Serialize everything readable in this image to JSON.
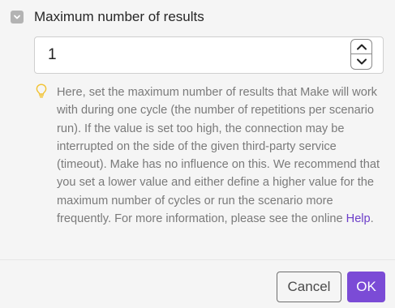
{
  "field": {
    "label": "Maximum number of results",
    "value": "1",
    "collapse_icon": "chevron-down-icon",
    "stepper_icons": [
      "chevron-up-icon",
      "chevron-down-icon"
    ]
  },
  "hint": {
    "icon": "lightbulb-icon",
    "text": "Here, set the maximum number of results that Make will work with during one cycle (the number of repetitions per scenario run). If the value is set too high, the connection may be interrupted on the side of the given third-party service (timeout). Make has no influence on this. We recommend that you set a lower value and either define a higher value for the maximum number of cycles or run the scenario more frequently. For more information, please see the online ",
    "link_text": "Help",
    "trailing": "."
  },
  "footer": {
    "cancel_label": "Cancel",
    "ok_label": "OK"
  },
  "colors": {
    "accent": "#7b4bd6",
    "link": "#6d3fc9",
    "hint_icon": "#f2c230",
    "background": "#f5f5f5"
  }
}
